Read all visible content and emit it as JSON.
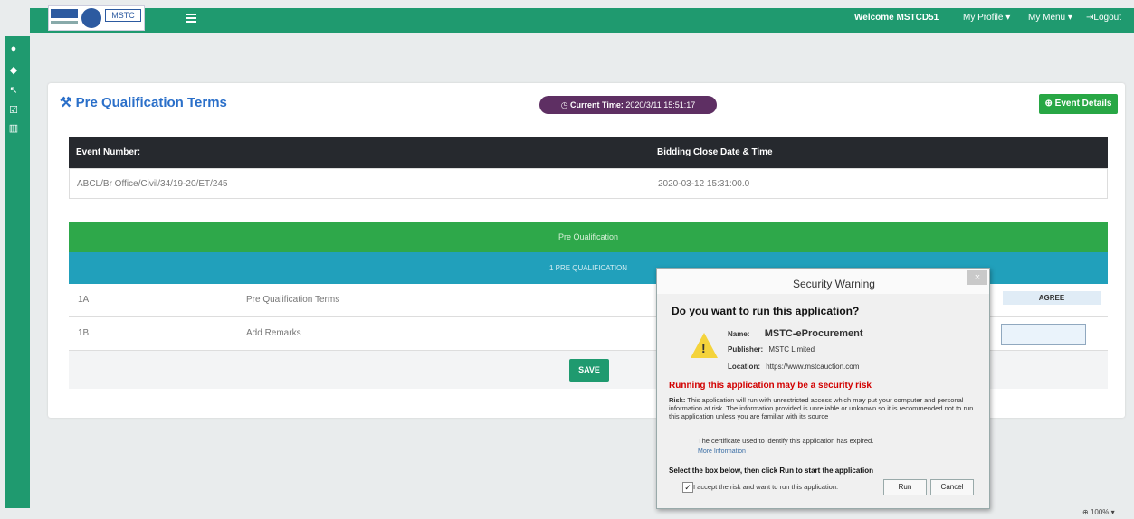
{
  "header": {
    "logo_text": "MSTC",
    "welcome": "Welcome MSTCD51",
    "my_profile": "My Profile ▾",
    "my_menu": "My Menu ▾",
    "logout": "Logout"
  },
  "page": {
    "title": "Pre Qualification Terms",
    "current_time_label": "Current Time:",
    "current_time_value": "2020/3/11 15:51:17",
    "event_details_button": "Event Details"
  },
  "event_table": {
    "headers": [
      "Event Number:",
      "Bidding Close Date & Time"
    ],
    "row": [
      "ABCL/Br Office/Civil/34/19-20/ET/245",
      "2020-03-12 15:31:00.0"
    ]
  },
  "prequal": {
    "section_title": "Pre Qualification",
    "subsection_title": "1 PRE QUALIFICATION",
    "rows": [
      {
        "id": "1A",
        "label": "Pre Qualification Terms",
        "action": "AGREE"
      },
      {
        "id": "1B",
        "label": "Add Remarks"
      }
    ],
    "save_button": "SAVE"
  },
  "dialog": {
    "title": "Security Warning",
    "close": "×",
    "question": "Do you want to run this application?",
    "name_label": "Name:",
    "name_value": "MSTC-eProcurement",
    "publisher_label": "Publisher:",
    "publisher_value": "MSTC Limited",
    "location_label": "Location:",
    "location_value": "https://www.mstcauction.com",
    "risk_heading": "Running this application may be a security risk",
    "risk_label": "Risk:",
    "risk_text": "This application will run with unrestricted access which may put your computer and personal information at risk. The information provided is unreliable or unknown so it is recommended not to run this application unless you are familiar with its source",
    "cert_text": "The certificate used to identify this application has expired.",
    "more_info": "More Information",
    "select_text": "Select the box below, then click Run to start the application",
    "accept_text": "I accept the risk and want to run this application.",
    "run_button": "Run",
    "cancel_button": "Cancel"
  },
  "status": {
    "zoom": "100%"
  },
  "colors": {
    "primary_green": "#1f9a6f",
    "accent_purple": "#5e2f63",
    "section_green": "#2ea84a",
    "section_cyan": "#21a0bb",
    "warning_red": "#d20000"
  }
}
